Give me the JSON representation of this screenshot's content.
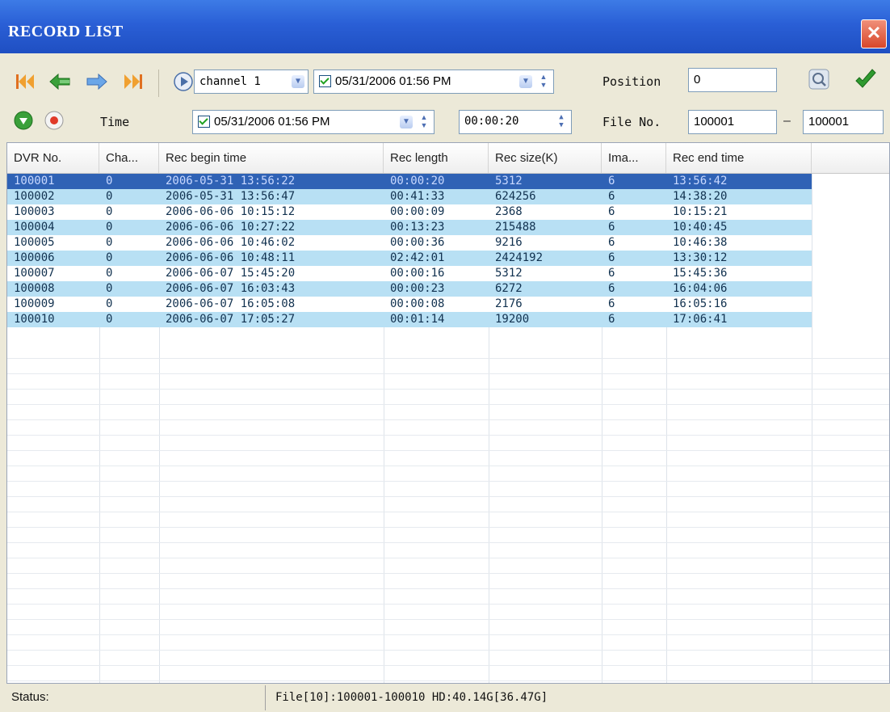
{
  "window": {
    "title": "RECORD LIST",
    "close_label": "✕"
  },
  "toolbar": {
    "channel_value": "channel 1",
    "start_datetime": "05/31/2006 01:56 PM",
    "time_label": "Time",
    "end_datetime": "05/31/2006 01:56 PM",
    "duration": "00:00:20",
    "position_label": "Position",
    "position_value": "0",
    "fileno_label": "File No.",
    "file_from": "100001",
    "file_dash": "–",
    "file_to": "100001"
  },
  "table": {
    "columns": [
      "DVR No.",
      "Cha...",
      "Rec begin time",
      "Rec length",
      "Rec size(K)",
      "Ima...",
      "Rec end time"
    ],
    "rows": [
      [
        "100001",
        "0",
        "2006-05-31 13:56:22",
        "00:00:20",
        "5312",
        "6",
        "13:56:42"
      ],
      [
        "100002",
        "0",
        "2006-05-31 13:56:47",
        "00:41:33",
        "624256",
        "6",
        "14:38:20"
      ],
      [
        "100003",
        "0",
        "2006-06-06 10:15:12",
        "00:00:09",
        "2368",
        "6",
        "10:15:21"
      ],
      [
        "100004",
        "0",
        "2006-06-06 10:27:22",
        "00:13:23",
        "215488",
        "6",
        "10:40:45"
      ],
      [
        "100005",
        "0",
        "2006-06-06 10:46:02",
        "00:00:36",
        "9216",
        "6",
        "10:46:38"
      ],
      [
        "100006",
        "0",
        "2006-06-06 10:48:11",
        "02:42:01",
        "2424192",
        "6",
        "13:30:12"
      ],
      [
        "100007",
        "0",
        "2006-06-07 15:45:20",
        "00:00:16",
        "5312",
        "6",
        "15:45:36"
      ],
      [
        "100008",
        "0",
        "2006-06-07 16:03:43",
        "00:00:23",
        "6272",
        "6",
        "16:04:06"
      ],
      [
        "100009",
        "0",
        "2006-06-07 16:05:08",
        "00:00:08",
        "2176",
        "6",
        "16:05:16"
      ],
      [
        "100010",
        "0",
        "2006-06-07 17:05:27",
        "00:01:14",
        "19200",
        "6",
        "17:06:41"
      ]
    ],
    "selected_row": 0
  },
  "status": {
    "label": "Status:",
    "text": "File[10]:100001-100010  HD:40.14G[36.47G]"
  },
  "colors": {
    "title_bar": "#2a5fd6",
    "selected_row": "#2f62b5",
    "row_alt": "#b8e0f4"
  }
}
